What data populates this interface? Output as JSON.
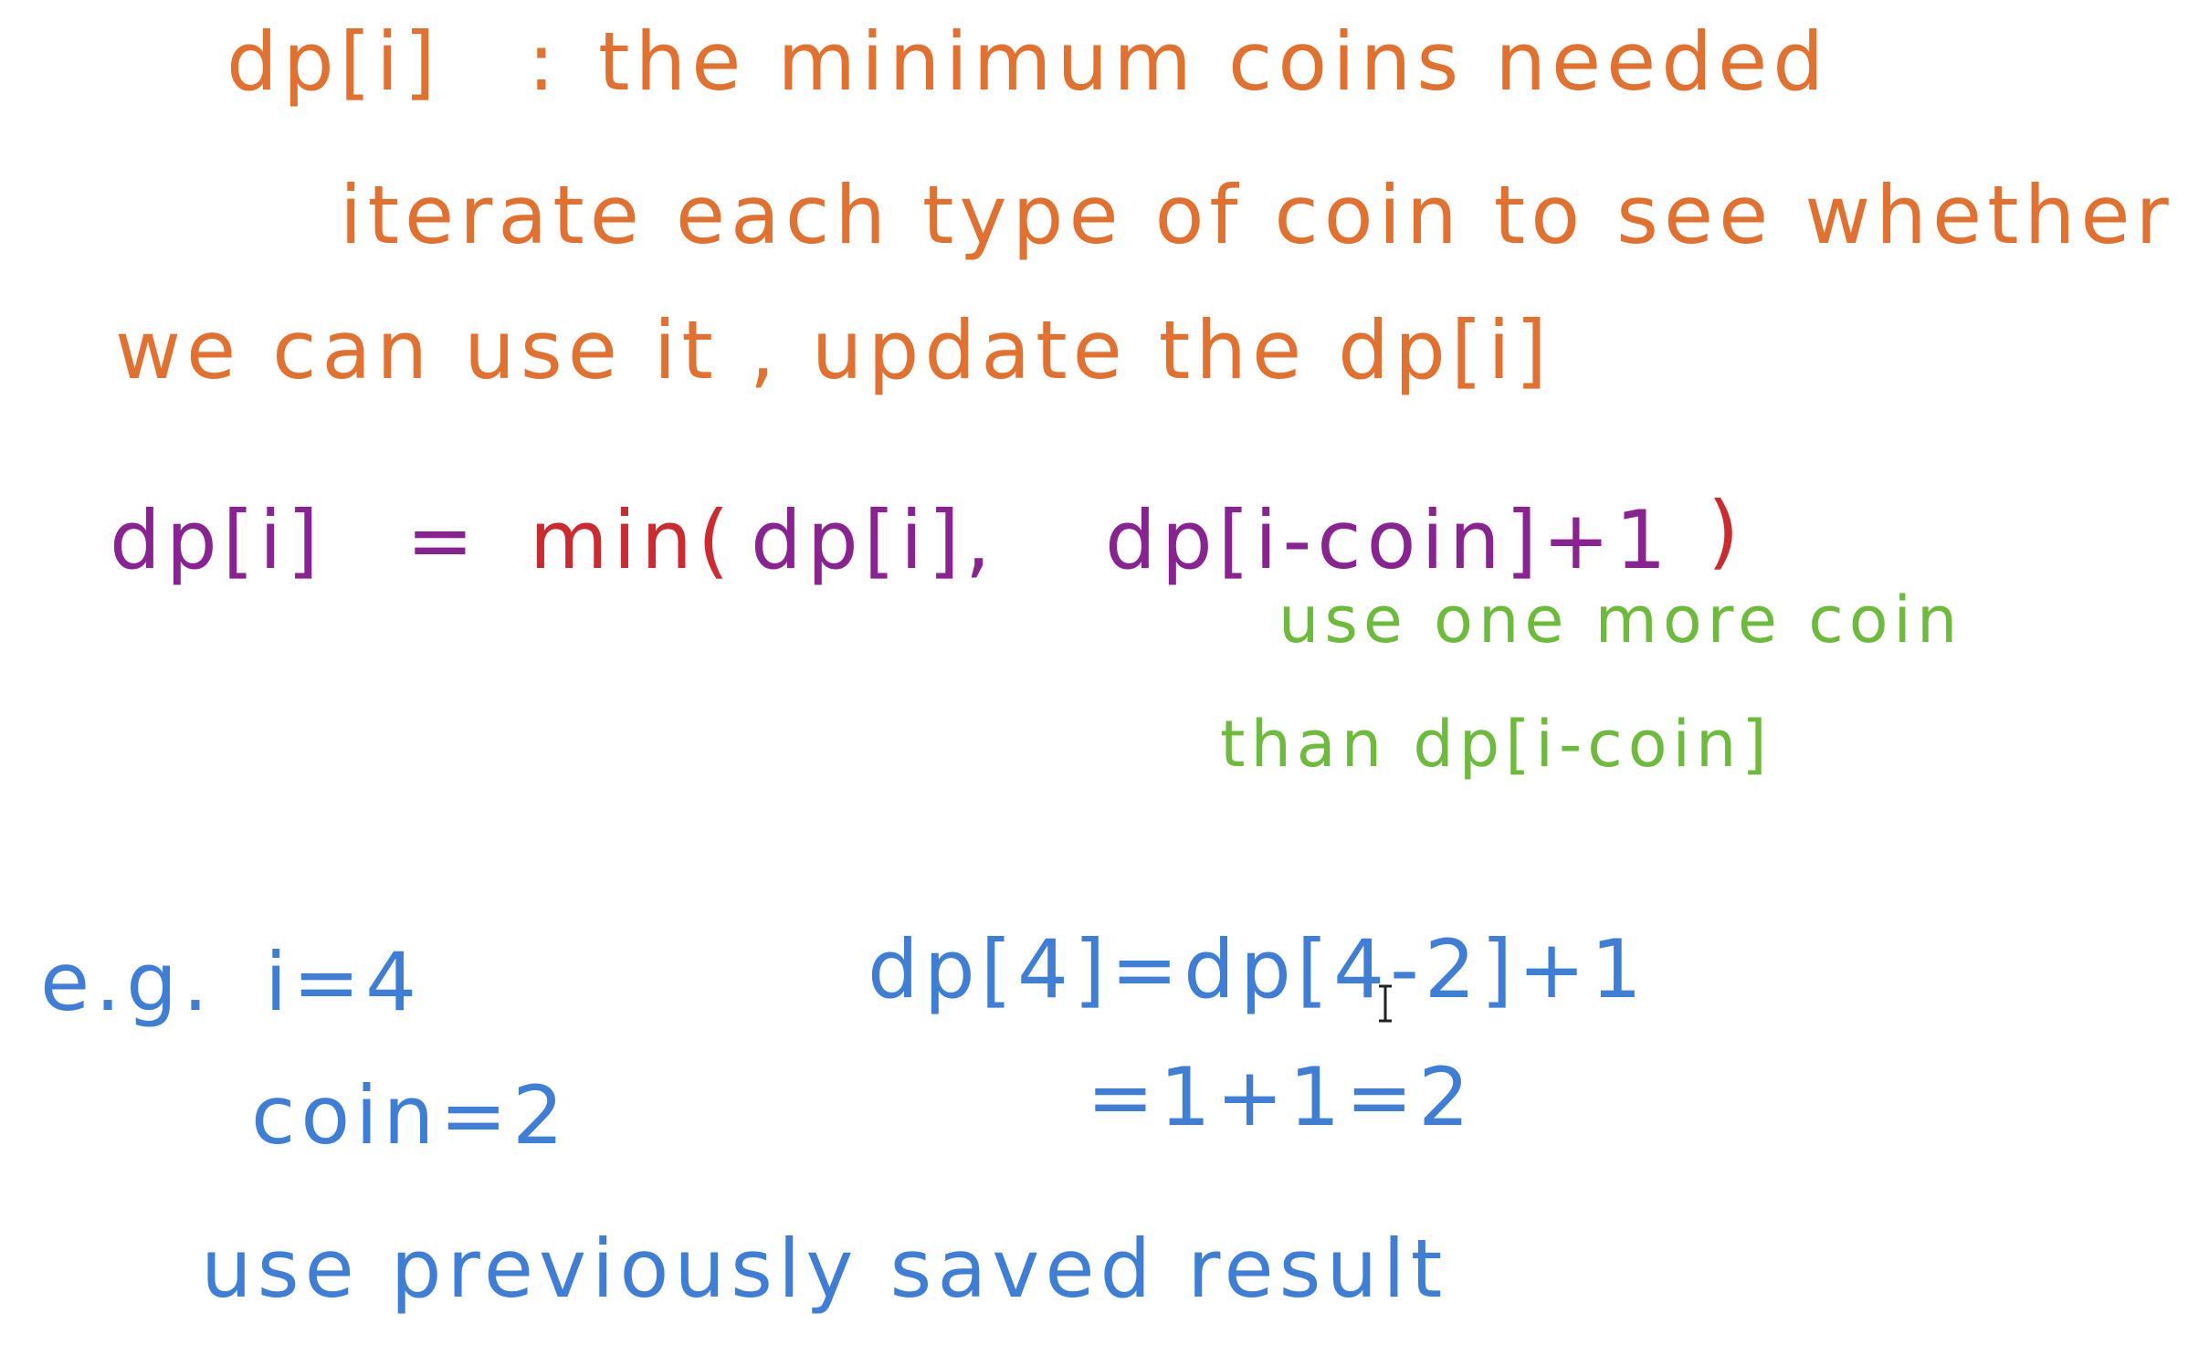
{
  "whiteboard": {
    "line_definition": {
      "term": "dp[i]",
      "separator": ":",
      "meaning": "the minimum coins needed"
    },
    "line_iterate_1": "iterate each type of coin to see whether",
    "line_iterate_2": "we can use it , update the dp[i]",
    "formula": {
      "lhs": "dp[i]",
      "equals": "=",
      "fn": "min(",
      "arg1": "dp[i],",
      "arg2": "dp[i-coin]+1",
      "close": ")"
    },
    "annotation_1": "use one more coin",
    "annotation_2": "than dp[i-coin]",
    "example": {
      "prefix": "e.g.",
      "i_value": "i=4",
      "coin_value": "coin=2",
      "calc_1": "dp[4]=dp[4-2]+1",
      "calc_2": "=1+1=2",
      "conclusion": "use previously saved result"
    }
  },
  "colors": {
    "orange": "#e2702f",
    "purple": "#8a2392",
    "red": "#cc2a2f",
    "green": "#6dbb3a",
    "blue": "#3f7ed6"
  },
  "cursor_icon": "text-cursor-icon"
}
